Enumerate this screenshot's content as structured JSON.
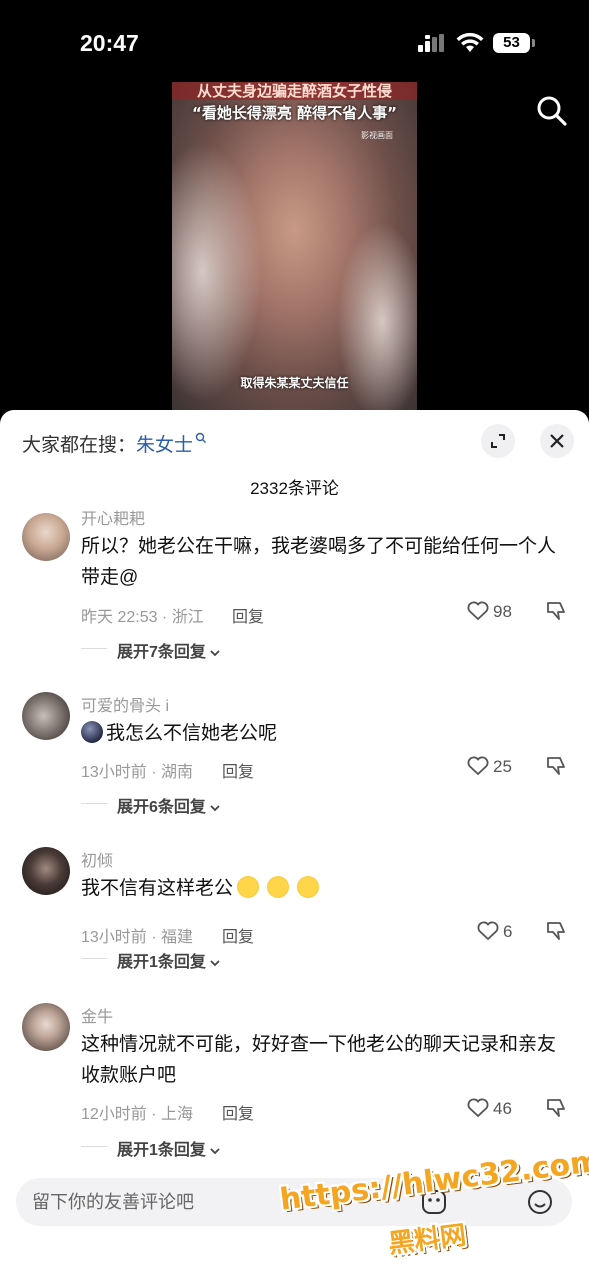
{
  "status_bar": {
    "time": "20:47",
    "battery": "53"
  },
  "video": {
    "title_top": "从丈夫身边骗走醉酒女子性侵",
    "title_sub": "“看她长得漂亮 醉得不省人事”",
    "tag": "影视画面",
    "caption": "取得朱某某丈夫信任"
  },
  "sheet": {
    "trending_prefix": "大家都在搜：",
    "trending_term": "朱女士",
    "comment_count": "2332条评论"
  },
  "comments": [
    {
      "username": "开心耙耙",
      "text": "所以？她老公在干嘛，我老婆喝多了不可能给任何一个人带走@",
      "time_location": "昨天 22:53 · 浙江",
      "reply_label": "回复",
      "likes": "98",
      "expand_label": "展开7条回复"
    },
    {
      "username": "可爱的骨头 i",
      "text": "我怎么不信她老公呢",
      "time_location": "13小时前 · 湖南",
      "reply_label": "回复",
      "likes": "25",
      "expand_label": "展开6条回复"
    },
    {
      "username": "初倾",
      "text": "我不信有这样老公",
      "time_location": "13小时前 · 福建",
      "reply_label": "回复",
      "likes": "6",
      "expand_label": "展开1条回复"
    },
    {
      "username": "金牛",
      "text": "这种情况就不可能，好好查一下他老公的聊天记录和亲友收款账户吧",
      "time_location": "12小时前 · 上海",
      "reply_label": "回复",
      "likes": "46",
      "expand_label": "展开1条回复"
    }
  ],
  "input": {
    "placeholder": "留下你的友善评论吧"
  },
  "watermark": {
    "url": "https://hlwc32.com",
    "name": "黑料网"
  },
  "colors": {
    "link": "#2b5dab",
    "sheet_bg": "#ffffff",
    "watermark": "#f4a623"
  }
}
